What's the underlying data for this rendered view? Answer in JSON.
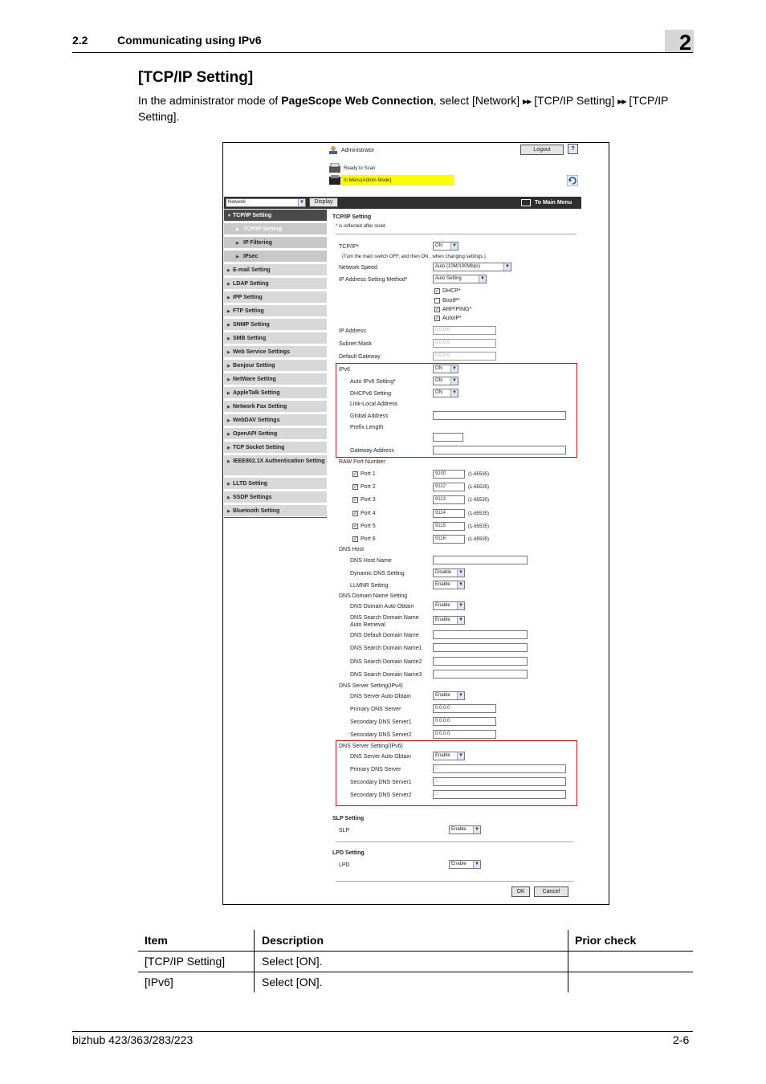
{
  "header": {
    "section_number": "2.2",
    "section_title": "Communicating using IPv6",
    "chapter_number": "2"
  },
  "section_heading": "[TCP/IP Setting]",
  "intro": {
    "prefix": "In the administrator mode of ",
    "product": "PageScope Web Connection",
    "middle": ", select [Network] ",
    "step1": " [TCP/IP Setting] ",
    "step2": " [TCP/IP",
    "line2": "Setting]."
  },
  "screenshot": {
    "admin_label": "Administrator",
    "logout_button": "Logout",
    "help_button": "?",
    "status_line1": "Ready to Scan",
    "status_line2": "In Menu(Admin Mode)",
    "category_select": "Network",
    "display_button": "Display",
    "to_main_menu": "To Main Menu",
    "nav": [
      {
        "label": "TCP/IP Setting",
        "state": "active"
      },
      {
        "label": "TCP/IP Setting",
        "state": "selected"
      },
      {
        "label": "IP Filtering",
        "state": "sub"
      },
      {
        "label": "IPsec",
        "state": "sub"
      },
      {
        "label": "E-mail Setting"
      },
      {
        "label": "LDAP Setting"
      },
      {
        "label": "IPP Setting"
      },
      {
        "label": "FTP Setting"
      },
      {
        "label": "SNMP Setting"
      },
      {
        "label": "SMB Setting"
      },
      {
        "label": "Web Service Settings"
      },
      {
        "label": "Bonjour Setting"
      },
      {
        "label": "NetWare Setting"
      },
      {
        "label": "AppleTalk Setting"
      },
      {
        "label": "Network Fax Setting"
      },
      {
        "label": "WebDAV Settings"
      },
      {
        "label": "OpenAPI Setting"
      },
      {
        "label": "TCP Socket Setting"
      },
      {
        "label": "IEEE802.1X Authentication Setting"
      },
      {
        "label": "LLTD Setting"
      },
      {
        "label": "SSDP Settings"
      },
      {
        "label": "Bluetooth Setting"
      }
    ],
    "form": {
      "title": "TCP/IP Setting",
      "note": "* is reflected after reset.",
      "tcpip_label": "TCP/IP*",
      "tcpip_value": "ON",
      "tcpip_hint": "(Turn the main switch OFF, and then ON , when changing settings.)",
      "network_speed_label": "Network Speed",
      "network_speed_value": "Auto (10M/100Mbps)",
      "ip_method_label": "IP Address Setting Method*",
      "ip_method_value": "Auto Setting",
      "dhcp": "DHCP*",
      "bootp": "BootP*",
      "arp": "ARP/PING*",
      "autoip": "AutoIP*",
      "ip_address_label": "IP Address",
      "ip_address_value": "0.0.0.0",
      "subnet_label": "Subnet Mask",
      "subnet_value": "0.0.0.0",
      "gateway_label": "Default Gateway",
      "gateway_value": "0.0.0.0",
      "ipv6_label": "IPv6",
      "ipv6_value": "ON",
      "auto_ipv6_label": "Auto IPv6 Setting*",
      "auto_ipv6_value": "ON",
      "dhcpv6_label": "DHCPv6 Setting",
      "dhcpv6_value": "ON",
      "link_local_label": "Link-Local Address",
      "global_label": "Global Address",
      "prefix_label": "Prefix Length",
      "ipv6_gateway_label": "Gateway Address",
      "raw_label": "RAW Port Number",
      "ports": [
        {
          "label": "Port 1",
          "value": "9100",
          "range": "(1-65535)"
        },
        {
          "label": "Port 2",
          "value": "9112",
          "range": "(1-65535)"
        },
        {
          "label": "Port 3",
          "value": "9113",
          "range": "(1-65535)"
        },
        {
          "label": "Port 4",
          "value": "9114",
          "range": "(1-65535)"
        },
        {
          "label": "Port 5",
          "value": "9115",
          "range": "(1-65535)"
        },
        {
          "label": "Port 6",
          "value": "9116",
          "range": "(1-65535)"
        }
      ],
      "dns_host_label": "DNS Host",
      "dns_host_name_label": "DNS Host Name",
      "dynamic_dns_label": "Dynamic DNS Setting",
      "dynamic_dns_value": "Disable",
      "llmnr_label": "LLMNR Setting",
      "llmnr_value": "Enable",
      "dns_domain_label": "DNS Domain Name Setting",
      "dns_domain_auto_label": "DNS Domain Auto Obtain",
      "dns_domain_auto_value": "Enable",
      "dns_search_auto_label1": "DNS Search Domain Name",
      "dns_search_auto_label2": "Auto Retrieval",
      "dns_search_auto_value": "Enable",
      "dns_default_domain_label": "DNS Default Domain Name",
      "dns_search1_label": "DNS Search Domain Name1",
      "dns_search2_label": "DNS Search Domain Name2",
      "dns_search3_label": "DNS Search Domain Name3",
      "dns_server4_label": "DNS Server Setting(IPv4)",
      "dns_server4_auto_label": "DNS Server Auto Obtain",
      "dns_server4_auto_value": "Enable",
      "primary4_label": "Primary DNS Server",
      "primary4_value": "0.0.0.0",
      "secondary4_1_label": "Secondary DNS Server1",
      "secondary4_1_value": "0.0.0.0",
      "secondary4_2_label": "Secondary DNS Server2",
      "secondary4_2_value": "0.0.0.0",
      "dns_server6_label": "DNS Server Setting(IPv6)",
      "dns_server6_auto_label": "DNS Server Auto Obtain",
      "dns_server6_auto_value": "Enable",
      "primary6_label": "Primary DNS Server",
      "primary6_value": "::",
      "secondary6_1_label": "Secondary DNS Server1",
      "secondary6_1_value": "::",
      "secondary6_2_label": "Secondary DNS Server2",
      "secondary6_2_value": "::",
      "slp_heading": "SLP Setting",
      "slp_label": "SLP",
      "slp_value": "Enable",
      "lpd_heading": "LPD Setting",
      "lpd_label": "LPD",
      "lpd_value": "Enable",
      "ok_button": "OK",
      "cancel_button": "Cancel"
    }
  },
  "table": {
    "headers": [
      "Item",
      "Description",
      "Prior check"
    ],
    "rows": [
      [
        "[TCP/IP Setting]",
        "Select [ON].",
        ""
      ],
      [
        "[IPv6]",
        "Select [ON].",
        ""
      ]
    ]
  },
  "footer": {
    "model": "bizhub 423/363/283/223",
    "page": "2-6"
  }
}
